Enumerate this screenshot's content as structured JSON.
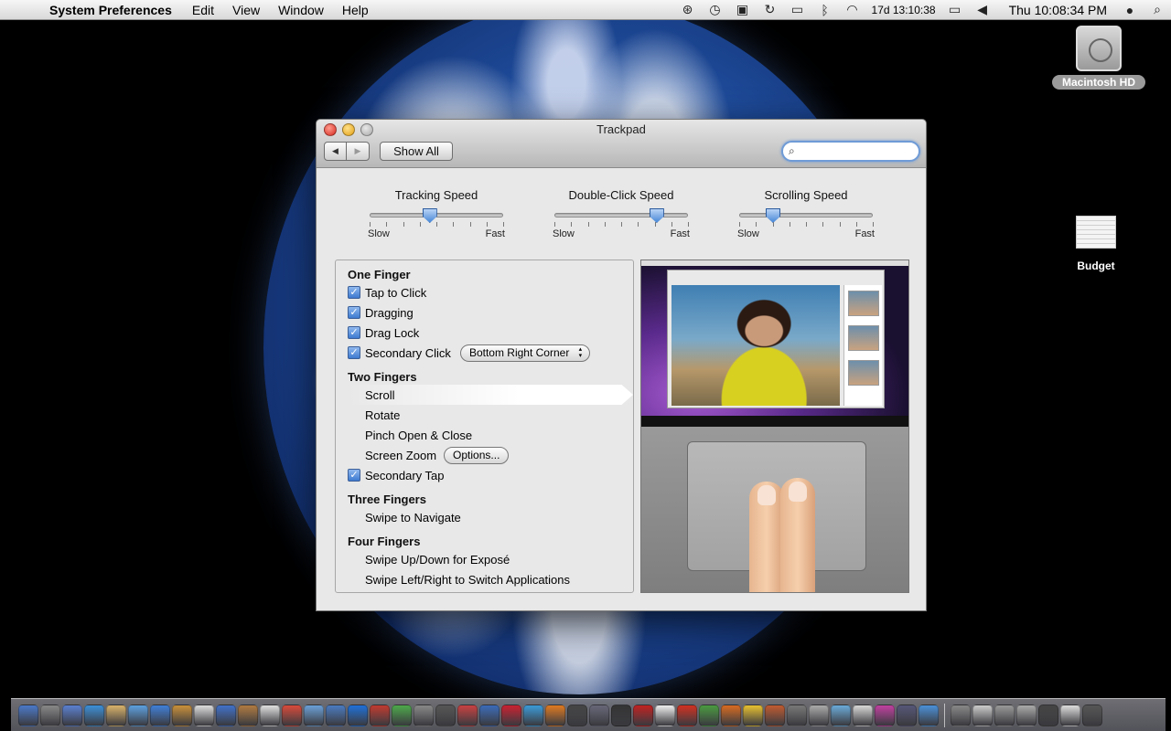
{
  "menubar": {
    "apple": "",
    "app_name": "System Preferences",
    "menus": [
      "Edit",
      "View",
      "Window",
      "Help"
    ],
    "status_text": "17d 13:10:38",
    "clock": "Thu 10:08:34 PM"
  },
  "desktop": {
    "hd_label": "Macintosh HD",
    "budget_label": "Budget"
  },
  "window": {
    "title": "Trackpad",
    "show_all": "Show All",
    "search_placeholder": ""
  },
  "sliders": [
    {
      "title": "Tracking Speed",
      "min_label": "Slow",
      "max_label": "Fast",
      "value": 0.45
    },
    {
      "title": "Double-Click Speed",
      "min_label": "Slow",
      "max_label": "Fast",
      "value": 0.77
    },
    {
      "title": "Scrolling Speed",
      "min_label": "Slow",
      "max_label": "Fast",
      "value": 0.25
    }
  ],
  "gestures": {
    "one_finger": {
      "title": "One Finger",
      "tap_to_click": "Tap to Click",
      "dragging": "Dragging",
      "drag_lock": "Drag Lock",
      "secondary_click": "Secondary Click",
      "secondary_click_option": "Bottom Right Corner"
    },
    "two_fingers": {
      "title": "Two Fingers",
      "scroll": "Scroll",
      "rotate": "Rotate",
      "pinch": "Pinch Open & Close",
      "screen_zoom": "Screen Zoom",
      "options_button": "Options...",
      "secondary_tap": "Secondary Tap"
    },
    "three_fingers": {
      "title": "Three Fingers",
      "swipe": "Swipe to Navigate"
    },
    "four_fingers": {
      "title": "Four Fingers",
      "swipe_updown": "Swipe Up/Down for Exposé",
      "swipe_leftright": "Swipe Left/Right to Switch Applications"
    }
  },
  "checkmark": "✓",
  "colors": {
    "accent": "#3d7ad0",
    "close": "#d7281e",
    "minimize": "#e2a012"
  }
}
